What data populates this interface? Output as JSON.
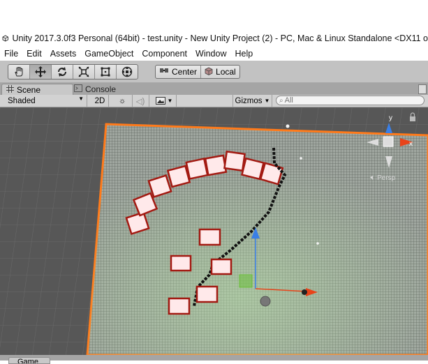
{
  "window": {
    "title": "Unity 2017.3.0f3 Personal (64bit) - test.unity - New Unity Project (2) - PC, Mac & Linux Standalone <DX11 o"
  },
  "menu": [
    "File",
    "Edit",
    "Assets",
    "GameObject",
    "Component",
    "Window",
    "Help"
  ],
  "toolbar": {
    "tools": [
      {
        "name": "hand-tool",
        "icon": "hand-icon",
        "active": false
      },
      {
        "name": "move-tool",
        "icon": "move-icon",
        "active": true
      },
      {
        "name": "rotate-tool",
        "icon": "rotate-icon",
        "active": false
      },
      {
        "name": "scale-tool",
        "icon": "scale-icon",
        "active": false
      },
      {
        "name": "rect-tool",
        "icon": "rect-icon",
        "active": false
      },
      {
        "name": "transform-tool",
        "icon": "transform-icon",
        "active": false
      }
    ],
    "pivot_label": "Center",
    "space_label": "Local"
  },
  "tabs": {
    "scene": "Scene",
    "console": "Console",
    "game": "Game"
  },
  "scene_options": {
    "shading": "Shaded",
    "mode_2d": "2D",
    "gizmos": "Gizmos",
    "search_placeholder": "All"
  },
  "scene_gizmo": {
    "axis_y": "y",
    "axis_x": "x",
    "persp": "Persp"
  },
  "colors": {
    "grid_border": "#ff7a1a",
    "cube_face": "#ffe9ea",
    "cube_edge": "#a31a12",
    "axis_x": "#e8441a",
    "axis_y": "#3a7fe6",
    "axis_z": "#6bbf3a"
  }
}
